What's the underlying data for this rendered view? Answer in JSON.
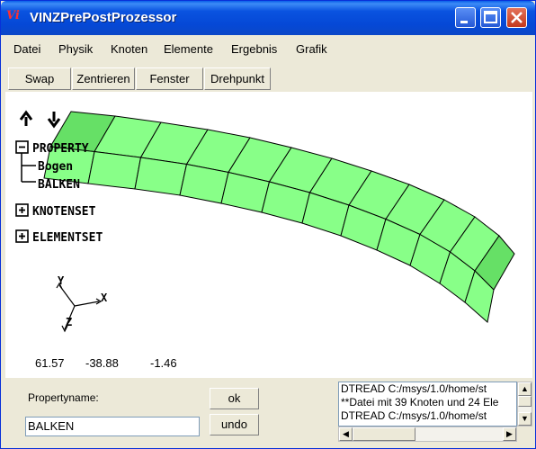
{
  "window": {
    "title": "VINZPrePostProzessor",
    "icon_text": "Vi"
  },
  "menu": [
    "Datei",
    "Physik",
    "Knoten",
    "Elemente",
    "Ergebnis",
    "Grafik"
  ],
  "toolbar": [
    "Swap",
    "Zentrieren",
    "Fenster",
    "Drehpunkt"
  ],
  "tree": {
    "property": "PROPERTY",
    "property_children": [
      "Bogen",
      "BALKEN"
    ],
    "knotenset": "KNOTENSET",
    "elementset": "ELEMENTSET"
  },
  "axes": {
    "x": "X",
    "y": "Y",
    "z": "Z"
  },
  "coords": [
    "61.57",
    "-38.88",
    "-1.46"
  ],
  "form": {
    "label": "Propertyname:",
    "value": "BALKEN",
    "ok_label": "ok",
    "undo_label": "undo"
  },
  "log": [
    "DTREAD C:/msys/1.0/home/st",
    "**Datei mit 39 Knoten und 24 Ele",
    "DTREAD C:/msys/1.0/home/st"
  ],
  "colors": {
    "mesh_fill": "#88ff88",
    "mesh_dark": "#66e066",
    "title_bar": "#0a53e0"
  }
}
